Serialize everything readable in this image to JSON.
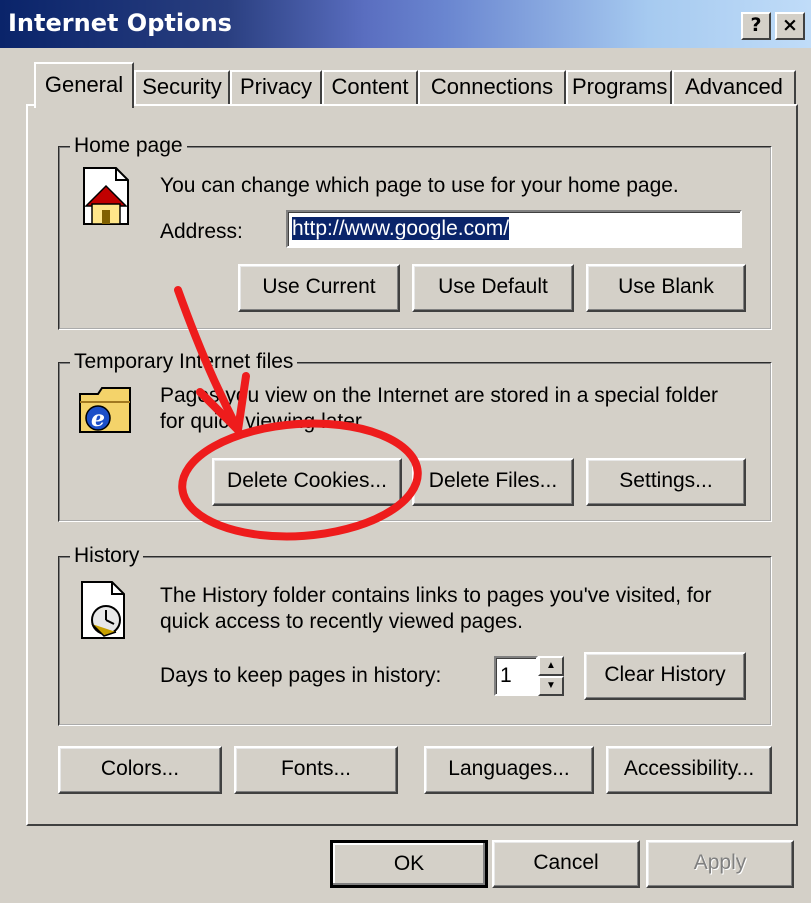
{
  "window": {
    "title": "Internet Options",
    "help_button": "?",
    "close_button": "×",
    "title_color": "#0a246a"
  },
  "tabs": [
    {
      "label": "General",
      "active": true
    },
    {
      "label": "Security"
    },
    {
      "label": "Privacy"
    },
    {
      "label": "Content"
    },
    {
      "label": "Connections"
    },
    {
      "label": "Programs"
    },
    {
      "label": "Advanced"
    }
  ],
  "home_page": {
    "legend": "Home page",
    "description": "You can change which page to use for your home page.",
    "address_label": "Address:",
    "address_value": "http://www.google.com/",
    "buttons": {
      "use_current": "Use Current",
      "use_default": "Use Default",
      "use_blank": "Use Blank"
    }
  },
  "temp_files": {
    "legend": "Temporary Internet files",
    "description_line1": "Pages you view on the Internet are stored in a special folder",
    "description_line2": "for quick viewing later.",
    "buttons": {
      "delete_cookies": "Delete Cookies...",
      "delete_files": "Delete Files...",
      "settings": "Settings..."
    }
  },
  "history": {
    "legend": "History",
    "description_line1": "The History folder contains links to pages you've visited, for",
    "description_line2": "quick access to recently viewed pages.",
    "days_label": "Days to keep pages in history:",
    "days_value": "1",
    "clear_button": "Clear History"
  },
  "bottom_buttons": {
    "colors": "Colors...",
    "fonts": "Fonts...",
    "languages": "Languages...",
    "accessibility": "Accessibility..."
  },
  "dialog_buttons": {
    "ok": "OK",
    "cancel": "Cancel",
    "apply": "Apply"
  },
  "annotation": {
    "color": "#ee1c1c",
    "icons": [
      "red-arrow",
      "red-circle"
    ]
  }
}
